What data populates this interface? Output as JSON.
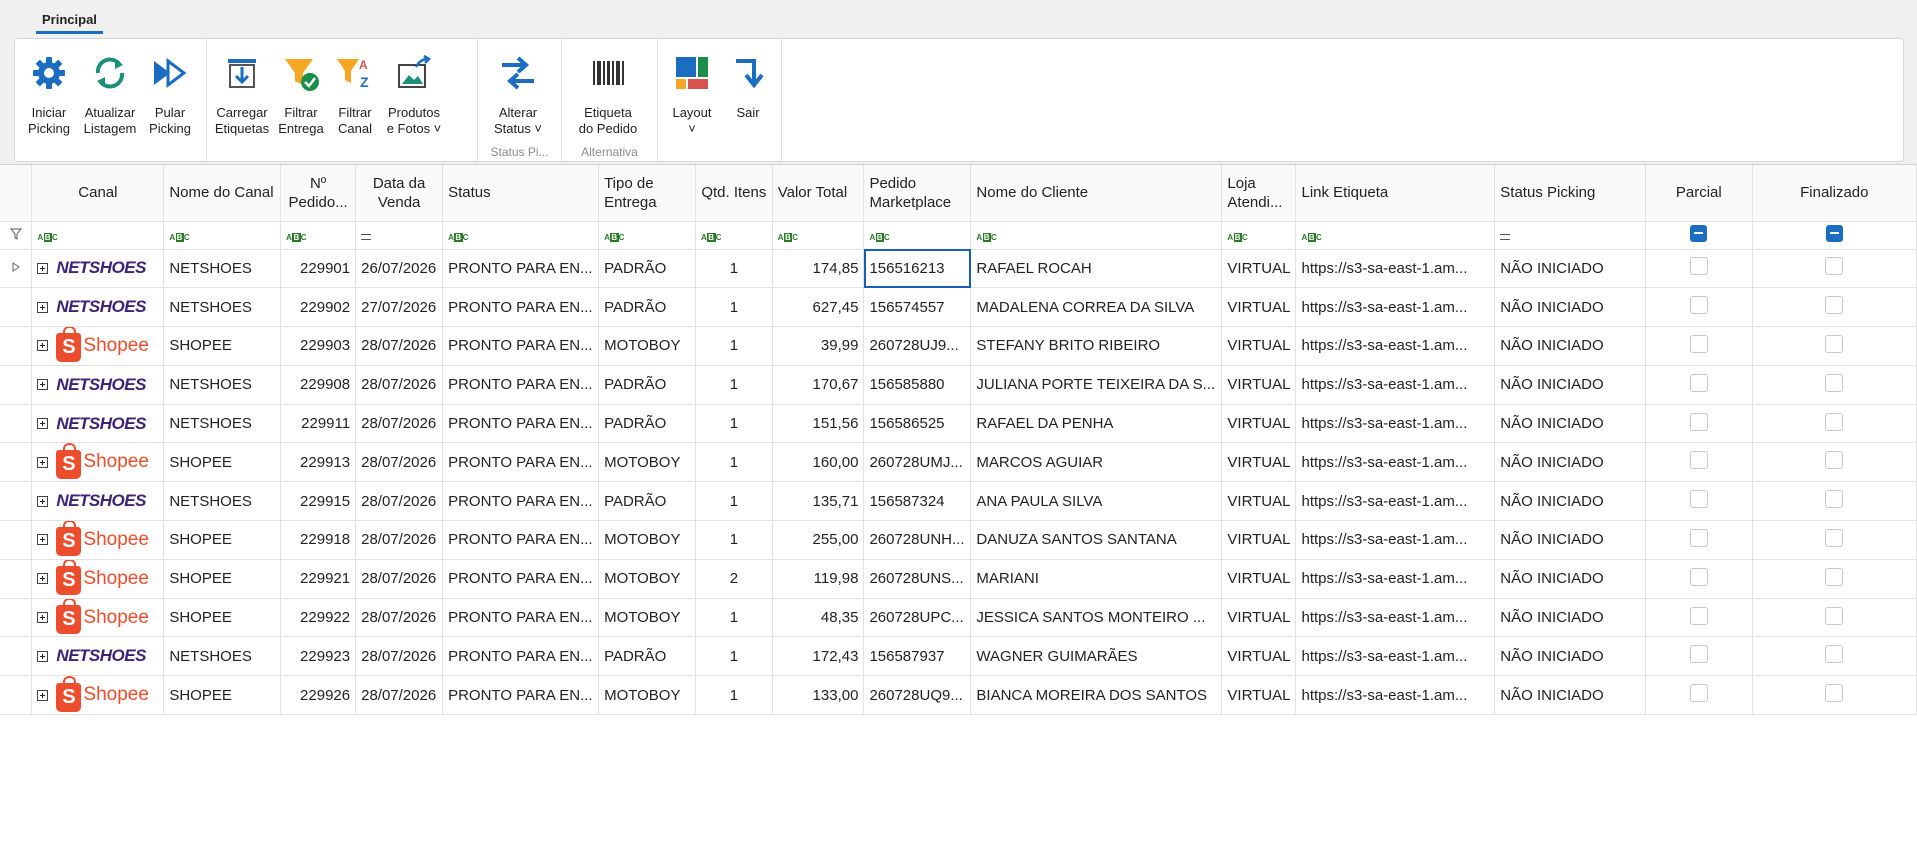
{
  "ribbon": {
    "tab_label": "Principal",
    "groups": [
      {
        "label": "",
        "buttons": [
          {
            "label": "Iniciar\nPicking",
            "icon": "gear-icon"
          },
          {
            "label": "Atualizar\nListagem",
            "icon": "refresh-icon"
          },
          {
            "label": "Pular\nPicking",
            "icon": "skip-forward-icon"
          }
        ]
      },
      {
        "label": "",
        "buttons": [
          {
            "label": "Carregar\nEtiquetas",
            "icon": "download-labels-icon"
          },
          {
            "label": "Filtrar\nEntrega",
            "icon": "filter-check-icon"
          },
          {
            "label": "Filtrar\nCanal",
            "icon": "filter-az-icon"
          },
          {
            "label": "Produtos\ne Fotos ˅",
            "icon": "product-photos-icon"
          }
        ]
      },
      {
        "label": "Status Pi...",
        "buttons": [
          {
            "label": "Alterar\nStatus ˅",
            "icon": "change-status-icon"
          }
        ]
      },
      {
        "label": "Alternativa",
        "buttons": [
          {
            "label": "Etiqueta\ndo Pedido",
            "icon": "barcode-icon"
          }
        ]
      },
      {
        "label": "",
        "buttons": [
          {
            "label": "Layout\n˅",
            "icon": "layout-icon"
          },
          {
            "label": "Sair",
            "icon": "exit-arrow-icon"
          }
        ]
      }
    ]
  },
  "grid": {
    "columns": [
      "Canal",
      "Nome do Canal",
      "Nº Pedido...",
      "Data da Venda",
      "Status",
      "Tipo de Entrega",
      "Qtd. Itens",
      "Valor Total",
      "Pedido Marketplace",
      "Nome do Cliente",
      "Loja Atendi...",
      "Link Etiqueta",
      "Status Picking",
      "Parcial",
      "Finalizado"
    ],
    "rows": [
      {
        "canal_logo": "NETSHOES",
        "nome_canal": "NETSHOES",
        "pedido": "229901",
        "data": "26/07/2026",
        "status": "PRONTO PARA EN...",
        "tipo": "PADRÃO",
        "qtd": "1",
        "valor": "174,85",
        "marketplace": "156516213",
        "cliente": "RAFAEL ROCAH",
        "loja": "VIRTUAL",
        "link": "https://s3-sa-east-1.am...",
        "status_picking": "NÃO INICIADO"
      },
      {
        "canal_logo": "NETSHOES",
        "nome_canal": "NETSHOES",
        "pedido": "229902",
        "data": "27/07/2026",
        "status": "PRONTO PARA EN...",
        "tipo": "PADRÃO",
        "qtd": "1",
        "valor": "627,45",
        "marketplace": "156574557",
        "cliente": "MADALENA CORREA DA SILVA",
        "loja": "VIRTUAL",
        "link": "https://s3-sa-east-1.am...",
        "status_picking": "NÃO INICIADO"
      },
      {
        "canal_logo": "Shopee",
        "nome_canal": "SHOPEE",
        "pedido": "229903",
        "data": "28/07/2026",
        "status": "PRONTO PARA EN...",
        "tipo": "MOTOBOY",
        "qtd": "1",
        "valor": "39,99",
        "marketplace": "260728UJ9...",
        "cliente": "STEFANY BRITO RIBEIRO",
        "loja": "VIRTUAL",
        "link": "https://s3-sa-east-1.am...",
        "status_picking": "NÃO INICIADO"
      },
      {
        "canal_logo": "NETSHOES",
        "nome_canal": "NETSHOES",
        "pedido": "229908",
        "data": "28/07/2026",
        "status": "PRONTO PARA EN...",
        "tipo": "PADRÃO",
        "qtd": "1",
        "valor": "170,67",
        "marketplace": "156585880",
        "cliente": "JULIANA PORTE TEIXEIRA DA S...",
        "loja": "VIRTUAL",
        "link": "https://s3-sa-east-1.am...",
        "status_picking": "NÃO INICIADO"
      },
      {
        "canal_logo": "NETSHOES",
        "nome_canal": "NETSHOES",
        "pedido": "229911",
        "data": "28/07/2026",
        "status": "PRONTO PARA EN...",
        "tipo": "PADRÃO",
        "qtd": "1",
        "valor": "151,56",
        "marketplace": "156586525",
        "cliente": "RAFAEL DA PENHA",
        "loja": "VIRTUAL",
        "link": "https://s3-sa-east-1.am...",
        "status_picking": "NÃO INICIADO"
      },
      {
        "canal_logo": "Shopee",
        "nome_canal": "SHOPEE",
        "pedido": "229913",
        "data": "28/07/2026",
        "status": "PRONTO PARA EN...",
        "tipo": "MOTOBOY",
        "qtd": "1",
        "valor": "160,00",
        "marketplace": "260728UMJ...",
        "cliente": "MARCOS AGUIAR",
        "loja": "VIRTUAL",
        "link": "https://s3-sa-east-1.am...",
        "status_picking": "NÃO INICIADO"
      },
      {
        "canal_logo": "NETSHOES",
        "nome_canal": "NETSHOES",
        "pedido": "229915",
        "data": "28/07/2026",
        "status": "PRONTO PARA EN...",
        "tipo": "PADRÃO",
        "qtd": "1",
        "valor": "135,71",
        "marketplace": "156587324",
        "cliente": "ANA PAULA  SILVA",
        "loja": "VIRTUAL",
        "link": "https://s3-sa-east-1.am...",
        "status_picking": "NÃO INICIADO"
      },
      {
        "canal_logo": "Shopee",
        "nome_canal": "SHOPEE",
        "pedido": "229918",
        "data": "28/07/2026",
        "status": "PRONTO PARA EN...",
        "tipo": "MOTOBOY",
        "qtd": "1",
        "valor": "255,00",
        "marketplace": "260728UNH...",
        "cliente": "DANUZA SANTOS SANTANA",
        "loja": "VIRTUAL",
        "link": "https://s3-sa-east-1.am...",
        "status_picking": "NÃO INICIADO"
      },
      {
        "canal_logo": "Shopee",
        "nome_canal": "SHOPEE",
        "pedido": "229921",
        "data": "28/07/2026",
        "status": "PRONTO PARA EN...",
        "tipo": "MOTOBOY",
        "qtd": "2",
        "valor": "119,98",
        "marketplace": "260728UNS...",
        "cliente": "MARIANI",
        "loja": "VIRTUAL",
        "link": "https://s3-sa-east-1.am...",
        "status_picking": "NÃO INICIADO"
      },
      {
        "canal_logo": "Shopee",
        "nome_canal": "SHOPEE",
        "pedido": "229922",
        "data": "28/07/2026",
        "status": "PRONTO PARA EN...",
        "tipo": "MOTOBOY",
        "qtd": "1",
        "valor": "48,35",
        "marketplace": "260728UPC...",
        "cliente": "JESSICA SANTOS MONTEIRO ...",
        "loja": "VIRTUAL",
        "link": "https://s3-sa-east-1.am...",
        "status_picking": "NÃO INICIADO"
      },
      {
        "canal_logo": "NETSHOES",
        "nome_canal": "NETSHOES",
        "pedido": "229923",
        "data": "28/07/2026",
        "status": "PRONTO PARA EN...",
        "tipo": "PADRÃO",
        "qtd": "1",
        "valor": "172,43",
        "marketplace": "156587937",
        "cliente": "WAGNER GUIMARÃES",
        "loja": "VIRTUAL",
        "link": "https://s3-sa-east-1.am...",
        "status_picking": "NÃO INICIADO"
      },
      {
        "canal_logo": "Shopee",
        "nome_canal": "SHOPEE",
        "pedido": "229926",
        "data": "28/07/2026",
        "status": "PRONTO PARA EN...",
        "tipo": "MOTOBOY",
        "qtd": "1",
        "valor": "133,00",
        "marketplace": "260728UQ9...",
        "cliente": "BIANCA MOREIRA DOS SANTOS",
        "loja": "VIRTUAL",
        "link": "https://s3-sa-east-1.am...",
        "status_picking": "NÃO INICIADO"
      }
    ]
  },
  "colors": {
    "accent": "#1a6dc0",
    "netshoes": "#3d2377",
    "shopee": "#ee4d2d",
    "filter_icon": "#f5a623"
  }
}
